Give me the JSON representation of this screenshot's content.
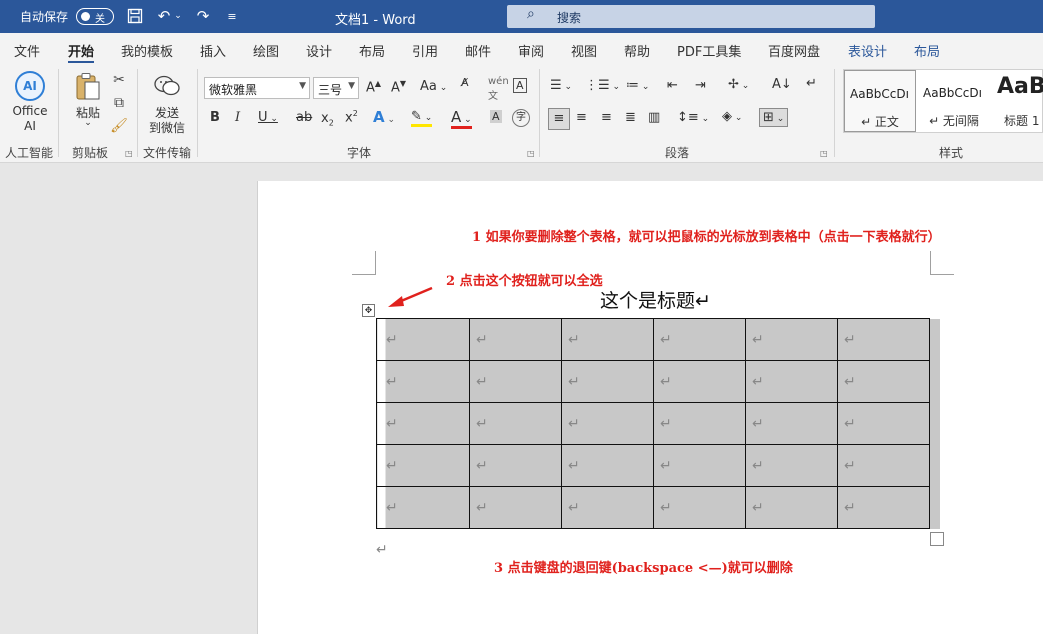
{
  "titlebar": {
    "autosave_label": "自动保存",
    "autosave_state": "关",
    "doc_title": "文档1  -  Word",
    "search_placeholder": "搜索",
    "icons": [
      "save-icon",
      "undo-icon",
      "redo-icon",
      "customize-icon",
      "search-icon"
    ]
  },
  "tabs": [
    "文件",
    "开始",
    "我的模板",
    "插入",
    "绘图",
    "设计",
    "布局",
    "引用",
    "邮件",
    "审阅",
    "视图",
    "帮助",
    "PDF工具集",
    "百度网盘",
    "表设计",
    "布局"
  ],
  "active_tab": "开始",
  "ribbon": {
    "ai": {
      "badge": "AI",
      "line1": "Office",
      "line2": "AI",
      "group": "人工智能"
    },
    "clipboard": {
      "paste": "粘贴",
      "group": "剪贴板"
    },
    "file_transfer": {
      "line1": "发送",
      "line2": "到微信",
      "group": "文件传输"
    },
    "font": {
      "name": "微软雅黑",
      "size": "三号",
      "group": "字体"
    },
    "paragraph": {
      "group": "段落"
    },
    "styles": {
      "group": "样式",
      "items": [
        {
          "sample": "AaBbCcDı",
          "name": "↵ 正文"
        },
        {
          "sample": "AaBbCcDı",
          "name": "↵ 无间隔"
        },
        {
          "sample": "AaB",
          "name": "标题 1"
        }
      ]
    }
  },
  "document": {
    "annotation_1": "1 如果你要删除整个表格，就可以把鼠标的光标放到表格中（点击一下表格就行）",
    "annotation_2": "2 点击这个按钮就可以全选",
    "annotation_3": "3 点击键盘的退回键(backspace <—)就可以删除",
    "heading": "这个是标题↵",
    "table": {
      "rows": 5,
      "cols": 6,
      "cell_mark": "↵",
      "selected": true
    },
    "paragraph_mark": "↵"
  },
  "colors": {
    "titlebar": "#2b579a",
    "annotation": "#e0211d",
    "selection": "#c8c8c8"
  }
}
